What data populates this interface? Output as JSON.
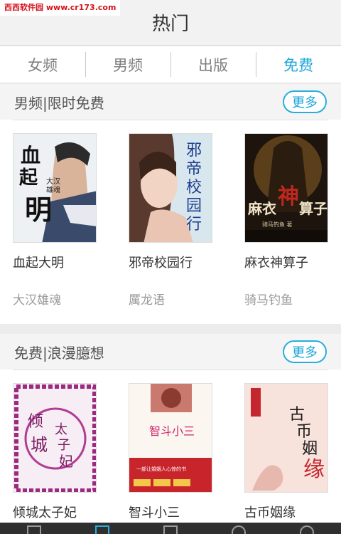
{
  "watermark": "西西软件园 www.cr173.com",
  "header": {
    "title": "热门"
  },
  "tabs": [
    {
      "label": "女频",
      "active": false
    },
    {
      "label": "男频",
      "active": false
    },
    {
      "label": "出版",
      "active": false
    },
    {
      "label": "免费",
      "active": true
    }
  ],
  "accent_color": "#1ba6d9",
  "sections": [
    {
      "title": "男频|限时免费",
      "more_label": "更多",
      "books": [
        {
          "title": "血起大明",
          "author": "大汉雄魂",
          "cover_text": "血起大明",
          "cover_sub": "大汉雄魂 著"
        },
        {
          "title": "邪帝校园行",
          "author": "厲龙语",
          "cover_text": "邪帝校园行",
          "cover_sub": ""
        },
        {
          "title": "麻衣神算子",
          "author": "骑马钓鱼",
          "cover_text": "麻衣神算子",
          "cover_sub": "骑马钓鱼 著"
        }
      ]
    },
    {
      "title": "免费|浪漫臆想",
      "more_label": "更多",
      "books": [
        {
          "title": "倾城太子妃",
          "author": "",
          "cover_text": "倾城太子妃",
          "cover_sub": ""
        },
        {
          "title": "智斗小三",
          "author": "",
          "cover_text": "智斗小三",
          "cover_sub": ""
        },
        {
          "title": "古币姻缘",
          "author": "",
          "cover_text": "古币姻缘",
          "cover_sub": ""
        }
      ]
    }
  ],
  "bottom_nav": [
    {
      "icon": "bookshelf-icon",
      "active": false
    },
    {
      "icon": "gift-icon",
      "active": true
    },
    {
      "icon": "grid-icon",
      "active": false
    },
    {
      "icon": "search-icon",
      "active": false
    },
    {
      "icon": "user-icon",
      "active": false
    }
  ]
}
